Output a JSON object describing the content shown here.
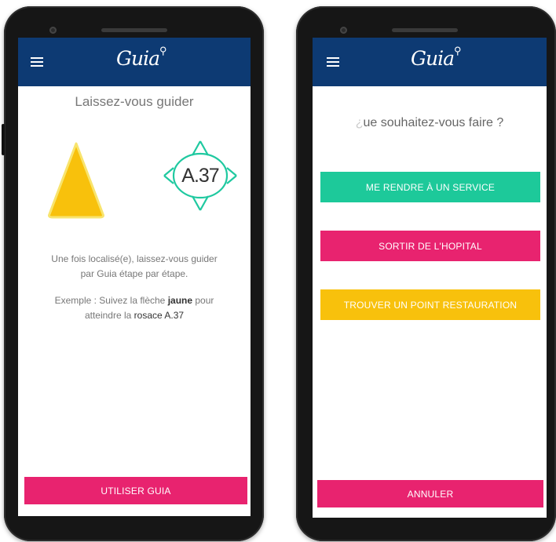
{
  "colors": {
    "app_bar": "#0d3a73",
    "green": "#1dc99a",
    "pink": "#e8236f",
    "yellow": "#f8c10c",
    "teal": "#1fc9a0",
    "text_gray": "#666666"
  },
  "left_screen": {
    "header": {
      "menu_icon": "hamburger-menu-icon",
      "logo": "Guia"
    },
    "title": "Laissez-vous guider",
    "rosace_label": "A.37",
    "description_line1": "Une fois localisé(e), laissez-vous guider",
    "description_line2": "par Guia étape par étape.",
    "example_prefix": "Exemple : Suivez la flèche ",
    "example_highlight1": "jaune",
    "example_mid": " pour",
    "example_line2_prefix": "atteindre la ",
    "example_highlight2": "rosace A.37",
    "cta_label": "UTILISER GUIA"
  },
  "right_screen": {
    "header": {
      "menu_icon": "hamburger-menu-icon",
      "logo": "Guia"
    },
    "question": "ue souhaitez-vous faire ?",
    "options": [
      {
        "label": "ME RENDRE À UN SERVICE",
        "color": "green"
      },
      {
        "label": "SORTIR DE L'HOPITAL",
        "color": "pink"
      },
      {
        "label": "TROUVER UN POINT RESTAURATION",
        "color": "yellow"
      }
    ],
    "cancel_label": "ANNULER"
  }
}
